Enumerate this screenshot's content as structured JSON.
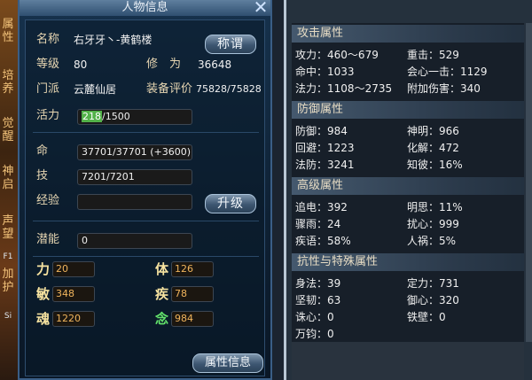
{
  "side_tabs": [
    "属性",
    "培养",
    "觉醒",
    "神启",
    "声望",
    "加护"
  ],
  "side_misc": [
    "F1",
    "Si"
  ],
  "panel": {
    "title": "人物信息"
  },
  "rows": {
    "name": {
      "label": "名称",
      "value": "右牙牙丶-黄鹤楼"
    },
    "title_button": "称谓",
    "level": {
      "label": "等级",
      "value": "80"
    },
    "cultivation": {
      "label": "修　为",
      "value": "36648"
    },
    "sect": {
      "label": "门派",
      "value": "云麓仙居"
    },
    "equip": {
      "label": "装备评价",
      "value": "75828/75828"
    },
    "vitality": {
      "label": "活力",
      "current": "218",
      "max": "/1500",
      "ratio": 0.145
    },
    "life": {
      "label": "命",
      "value": "37701/37701 (+3600)"
    },
    "skill": {
      "label": "技",
      "value": "7201/7201"
    },
    "exp": {
      "label": "经验",
      "value": ""
    },
    "upgrade_button": "升级",
    "potential": {
      "label": "潜能",
      "value": "0"
    }
  },
  "stats": [
    {
      "label": "力",
      "value": "20"
    },
    {
      "label": "体",
      "value": "126"
    },
    {
      "label": "敏",
      "value": "348"
    },
    {
      "label": "疾",
      "value": "78"
    },
    {
      "label": "魂",
      "value": "1220"
    },
    {
      "label": "念",
      "value": "984"
    }
  ],
  "attr_button": "属性信息",
  "right": {
    "sections": [
      {
        "title": "攻击属性",
        "items": [
          {
            "label": "攻力",
            "value": "460～679"
          },
          {
            "label": "重击",
            "value": "529"
          },
          {
            "label": "命中",
            "value": "1033"
          },
          {
            "label": "会心一击",
            "value": "1129"
          },
          {
            "label": "法力",
            "value": "1108～2735"
          },
          {
            "label": "附加伤害",
            "value": "340"
          }
        ]
      },
      {
        "title": "防御属性",
        "items": [
          {
            "label": "防御",
            "value": "984"
          },
          {
            "label": "神明",
            "value": "966"
          },
          {
            "label": "回避",
            "value": "1223"
          },
          {
            "label": "化解",
            "value": "472"
          },
          {
            "label": "法防",
            "value": "3241"
          },
          {
            "label": "知彼",
            "value": "16%"
          }
        ]
      },
      {
        "title": "高级属性",
        "items": [
          {
            "label": "追电",
            "value": "392"
          },
          {
            "label": "明思",
            "value": "11%"
          },
          {
            "label": "骤雨",
            "value": "24"
          },
          {
            "label": "扰心",
            "value": "999"
          },
          {
            "label": "疾语",
            "value": "58%"
          },
          {
            "label": "人祸",
            "value": "5%"
          }
        ]
      },
      {
        "title": "抗性与特殊属性",
        "items": [
          {
            "label": "身法",
            "value": "39"
          },
          {
            "label": "定力",
            "value": "731"
          },
          {
            "label": "坚韧",
            "value": "63"
          },
          {
            "label": "御心",
            "value": "320"
          },
          {
            "label": "诛心",
            "value": "0"
          },
          {
            "label": "铁壁",
            "value": "0"
          },
          {
            "label": "万钧",
            "value": "0"
          }
        ]
      }
    ]
  }
}
